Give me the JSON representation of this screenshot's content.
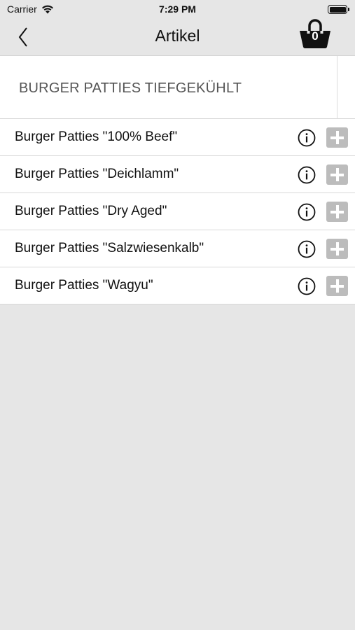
{
  "status_bar": {
    "carrier": "Carrier",
    "time": "7:29 PM",
    "wifi_icon": "wifi-icon",
    "battery_icon": "battery-icon"
  },
  "nav": {
    "title": "Artikel",
    "back_icon": "chevron-left-icon",
    "cart_icon": "shopping-basket-icon",
    "cart_count": "0"
  },
  "category": {
    "title": "BURGER PATTIES TIEFGEKÜHLT"
  },
  "products": [
    {
      "name": "Burger Patties \"100% Beef\""
    },
    {
      "name": "Burger Patties \"Deichlamm\""
    },
    {
      "name": "Burger Patties \"Dry Aged\""
    },
    {
      "name": "Burger Patties \"Salzwiesenkalb\""
    },
    {
      "name": "Burger Patties \"Wagyu\""
    }
  ],
  "colors": {
    "background": "#e6e6e6",
    "list_background": "#ffffff",
    "add_button": "#bcbcbc",
    "category_text": "#555555"
  }
}
